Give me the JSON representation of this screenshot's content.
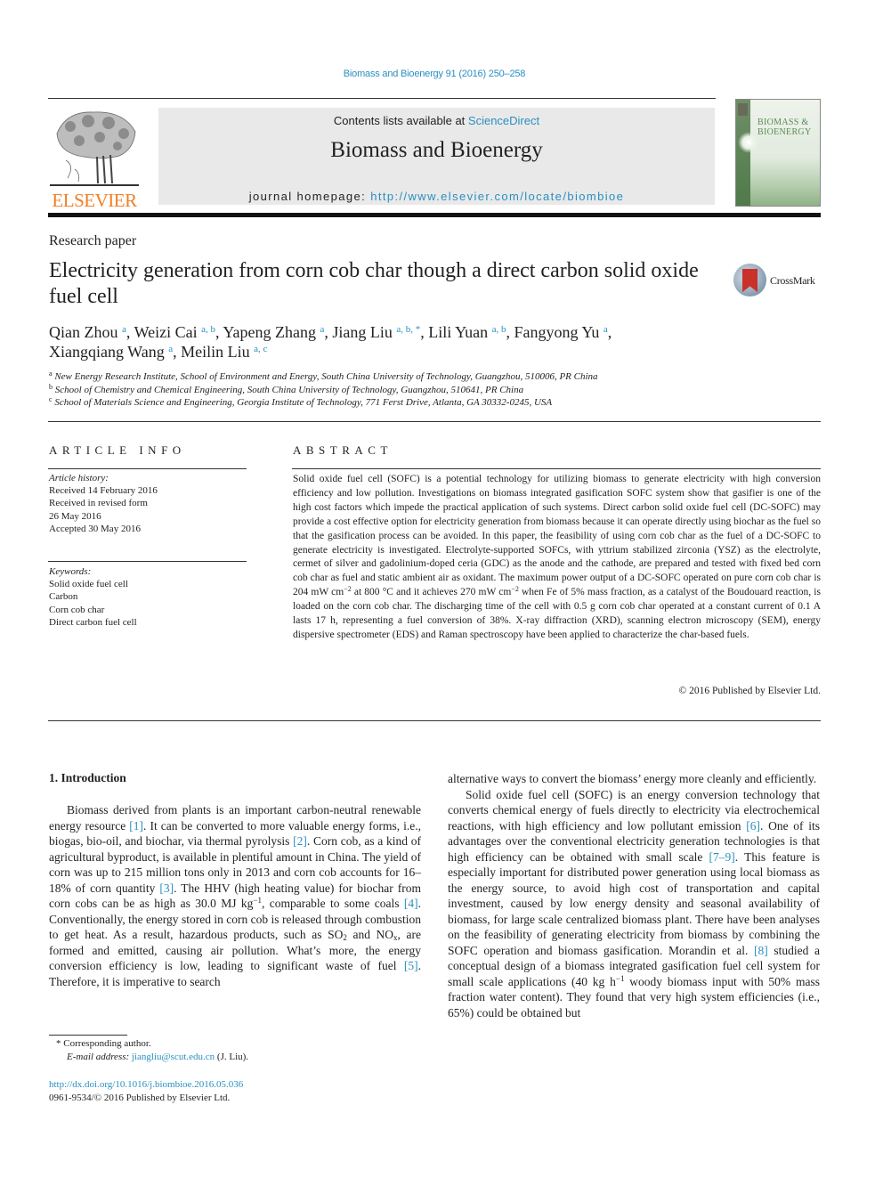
{
  "citation": "Biomass and Bioenergy 91 (2016) 250–258",
  "header": {
    "publisher_wordmark": "ELSEVIER",
    "contents_prefix": "Contents lists available at ",
    "contents_link": "ScienceDirect",
    "journal_name": "Biomass and Bioenergy",
    "homepage_prefix": "journal homepage: ",
    "homepage_url": "http://www.elsevier.com/locate/biombioe",
    "cover_title_line1": "BIOMASS &",
    "cover_title_line2": "BIOENERGY",
    "colors": {
      "link": "#2a8fc1",
      "elsevier_orange": "#f07e26",
      "header_box": "#e9e9e9"
    }
  },
  "article": {
    "type": "Research paper",
    "title": "Electricity generation from corn cob char though a direct carbon solid oxide fuel cell",
    "crossmark_label": "CrossMark",
    "authors": [
      {
        "name": "Qian Zhou",
        "affil": "a"
      },
      {
        "name": "Weizi Cai",
        "affil": "a, b"
      },
      {
        "name": "Yapeng Zhang",
        "affil": "a"
      },
      {
        "name": "Jiang Liu",
        "affil": "a, b, *"
      },
      {
        "name": "Lili Yuan",
        "affil": "a, b"
      },
      {
        "name": "Fangyong Yu",
        "affil": "a"
      },
      {
        "name": "Xiangqiang Wang",
        "affil": "a"
      },
      {
        "name": "Meilin Liu",
        "affil": "a, c"
      }
    ],
    "affiliations": [
      {
        "key": "a",
        "text": "New Energy Research Institute, School of Environment and Energy, South China University of Technology, Guangzhou, 510006, PR China"
      },
      {
        "key": "b",
        "text": "School of Chemistry and Chemical Engineering, South China University of Technology, Guangzhou, 510641, PR China"
      },
      {
        "key": "c",
        "text": "School of Materials Science and Engineering, Georgia Institute of Technology, 771 Ferst Drive, Atlanta, GA 30332-0245, USA"
      }
    ]
  },
  "article_info": {
    "heading": "ARTICLE INFO",
    "history_label": "Article history:",
    "history": [
      "Received 14 February 2016",
      "Received in revised form",
      "26 May 2016",
      "Accepted 30 May 2016"
    ],
    "keywords_label": "Keywords:",
    "keywords": [
      "Solid oxide fuel cell",
      "Carbon",
      "Corn cob char",
      "Direct carbon fuel cell"
    ]
  },
  "abstract": {
    "heading": "ABSTRACT",
    "part1": "Solid oxide fuel cell (SOFC) is a potential technology for utilizing biomass to generate electricity with high conversion efficiency and low pollution. Investigations on biomass integrated gasification SOFC system show that gasifier is one of the high cost factors which impede the practical application of such systems. Direct carbon solid oxide fuel cell (DC-SOFC) may provide a cost effective option for electricity generation from biomass because it can operate directly using biochar as the fuel so that the gasification process can be avoided. In this paper, the feasibility of using corn cob char as the fuel of a DC-SOFC to generate electricity is investigated. Electrolyte-supported SOFCs, with yttrium stabilized zirconia (YSZ) as the electrolyte, cermet of silver and gadolinium-doped ceria (GDC) as the anode and the cathode, are prepared and tested with fixed bed corn cob char as fuel and static ambient air as oxidant. The maximum power output of a DC-SOFC operated on pure corn cob char is 204 mW cm",
    "sup1": "−2",
    "part2": " at 800 °C and it achieves 270 mW cm",
    "sup2": "−2",
    "part3": " when Fe of 5% mass fraction, as a catalyst of the Boudouard reaction, is loaded on the corn cob char. The discharging time of the cell with 0.5 g corn cob char operated at a constant current of 0.1 A lasts 17 h, representing a fuel conversion of 38%. X-ray diffraction (XRD), scanning electron microscopy (SEM), energy dispersive spectrometer (EDS) and Raman spectroscopy have been applied to characterize the char-based fuels.",
    "copyright": "© 2016 Published by Elsevier Ltd."
  },
  "body": {
    "intro_heading": "1.  Introduction",
    "left": {
      "t1": "Biomass derived from plants is an important carbon-neutral renewable energy resource ",
      "r1": "[1]",
      "t2": ". It can be converted to more valuable energy forms, i.e., biogas, bio-oil, and biochar, via thermal pyrolysis ",
      "r2": "[2]",
      "t3": ". Corn cob, as a kind of agricultural byproduct, is available in plentiful amount in China. The yield of corn was up to 215 million tons only in 2013 and corn cob accounts for 16–18% of corn quantity ",
      "r3": "[3]",
      "t4": ". The HHV (high heating value) for biochar from corn cobs can be as high as 30.0 MJ kg",
      "s1": "−1",
      "t5": ", comparable to some coals ",
      "r4": "[4]",
      "t6": ". Conventionally, the energy stored in corn cob is released through combustion to get heat. As a result, hazardous products, such as SO",
      "sub1": "2",
      "t7": " and NO",
      "sub2": "x",
      "t8": ", are formed and emitted, causing air pollution. What’s more, the energy conversion efficiency is low, leading to significant waste of fuel ",
      "r5": "[5]",
      "t9": ". Therefore, it is imperative to search"
    },
    "right": {
      "p0": "alternative ways to convert the biomass’ energy more cleanly and efficiently.",
      "t1": "Solid oxide fuel cell (SOFC) is an energy conversion technology that converts chemical energy of fuels directly to electricity via electrochemical reactions, with high efficiency and low pollutant emission ",
      "r6": "[6]",
      "t2": ". One of its advantages over the conventional electricity generation technologies is that high efficiency can be obtained with small scale ",
      "r7": "[7–9]",
      "t3": ". This feature is especially important for distributed power generation using local biomass as the energy source, to avoid high cost of transportation and capital investment, caused by low energy density and seasonal availability of biomass, for large scale centralized biomass plant. There have been analyses on the feasibility of generating electricity from biomass by combining the SOFC operation and biomass gasification. Morandin et al. ",
      "r8": "[8]",
      "t4": " studied a conceptual design of a biomass integrated gasification fuel cell system for small scale applications (40 kg h",
      "s1": "−1",
      "t5": " woody biomass input with 50% mass fraction water content). They found that very high system efficiencies (i.e., 65%) could be obtained but"
    }
  },
  "footnotes": {
    "corresponding": "* Corresponding author.",
    "email_label": "E-mail address: ",
    "email": "jiangliu@scut.edu.cn",
    "email_suffix": " (J. Liu).",
    "doi": "http://dx.doi.org/10.1016/j.biombioe.2016.05.036",
    "issn": "0961-9534/© 2016 Published by Elsevier Ltd."
  }
}
